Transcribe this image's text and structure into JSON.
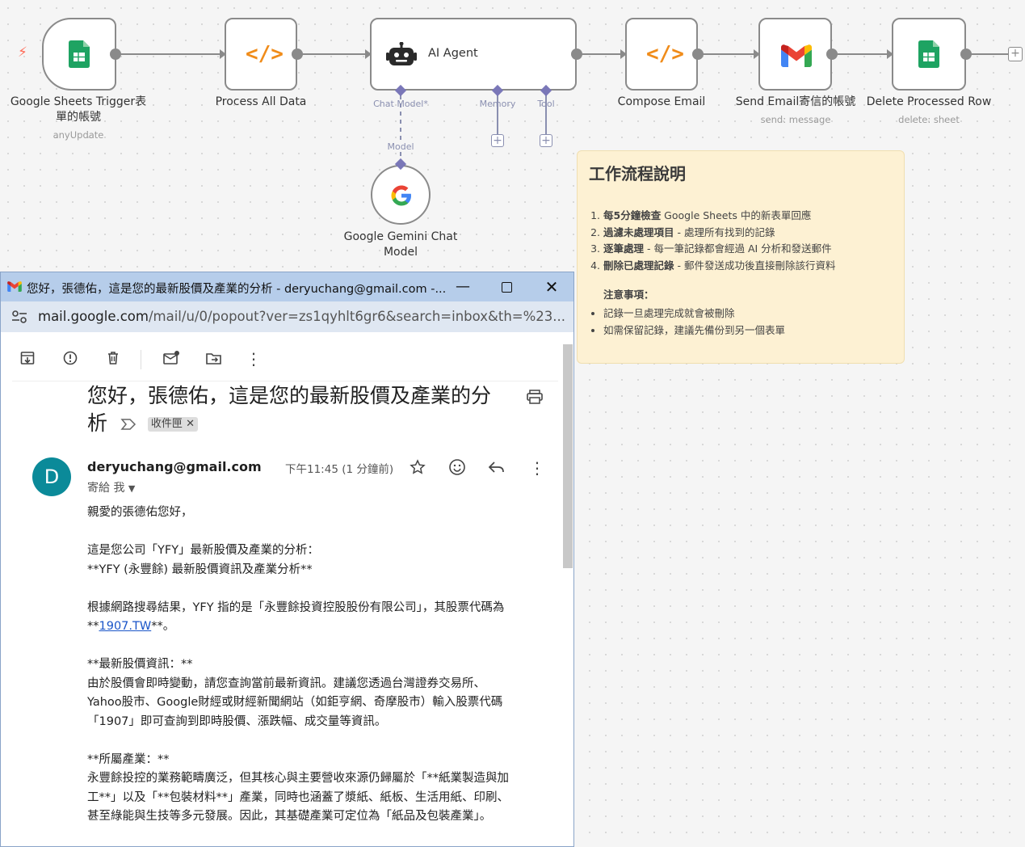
{
  "workflow": {
    "nodes": [
      {
        "label": "Google Sheets Trigger表單的帳號",
        "sub": "anyUpdate"
      },
      {
        "label": "Process All Data",
        "sub": ""
      },
      {
        "label": "AI Agent",
        "sub": ""
      },
      {
        "label": "Compose Email",
        "sub": ""
      },
      {
        "label": "Send Email寄信的帳號",
        "sub": "send: message"
      },
      {
        "label": "Delete Processed Row",
        "sub": "delete: sheet"
      }
    ],
    "agent_ports": {
      "chat_model": "Chat Model*",
      "memory": "Memory",
      "tool": "Tool"
    },
    "model_port_label": "Model",
    "model_node": {
      "label": "Google Gemini Chat Model"
    },
    "trigger_bolt": "⚡"
  },
  "sticky": {
    "title": "工作流程說明",
    "steps": [
      {
        "bold": "每5分鐘檢查",
        "rest": " Google Sheets 中的新表單回應"
      },
      {
        "bold": "過濾未處理項目",
        "rest": " - 處理所有找到的記錄"
      },
      {
        "bold": "逐筆處理",
        "rest": " - 每一筆記錄都會經過 AI 分析和發送郵件"
      },
      {
        "bold": "刪除已處理記錄",
        "rest": " - 郵件發送成功後直接刪除該行資料"
      }
    ],
    "note_title": "注意事項：",
    "notes": [
      "記錄一旦處理完成就會被刪除",
      "如需保留記錄，建議先備份到另一個表單"
    ]
  },
  "gmail": {
    "window_title": "您好，張德佑，這是您的最新股價及產業的分析 - deryuchang@gmail.com -...",
    "url_host": "mail.google.com",
    "url_path": "/mail/u/0/popout?ver=zs1qyhlt6gr6&search=inbox&th=%23...",
    "subject": "您好，張德佑，這是您的最新股價及產業的分析",
    "label_chip": "收件匣",
    "avatar_letter": "D",
    "sender": "deryuchang@gmail.com",
    "to": "寄給 我",
    "time": "下午11:45 (1 分鐘前)",
    "body": {
      "greeting": "親愛的張德佑您好，",
      "p1_l1": "這是您公司「YFY」最新股價及產業的分析：",
      "p1_l2": "**YFY (永豐餘) 最新股價資訊及產業分析**",
      "p2_l1": "根據網路搜尋結果，YFY 指的是「永豐餘投資控股股份有限公司」，其股票代碼為",
      "p2_pre": "**",
      "p2_link": "1907.TW",
      "p2_post": "**。",
      "p3_l1": "**最新股價資訊：**",
      "p3_l2": "由於股價會即時變動，請您查詢當前最新資訊。建議您透過台灣證券交易所、",
      "p3_l3": "Yahoo股市、Google財經或財經新聞網站（如鉅亨網、奇摩股市）輸入股票代碼",
      "p3_l4": "「1907」即可查詢到即時股價、漲跌幅、成交量等資訊。",
      "p4_l1": "**所屬產業：**",
      "p4_l2": "永豐餘投控的業務範疇廣泛，但其核心與主要營收來源仍歸屬於「**紙業製造與加",
      "p4_l3": "工**」以及「**包裝材料**」產業，同時也涵蓋了漿紙、紙板、生活用紙、印刷、",
      "p4_l4": "甚至綠能與生技等多元發展。因此，其基礎產業可定位為「紙品及包裝產業」。"
    }
  },
  "colors": {
    "sheets_green": "#1ea362",
    "code_orange": "#f08c1a",
    "port_purple": "#7a77b8",
    "avatar": "#0b8a99"
  }
}
